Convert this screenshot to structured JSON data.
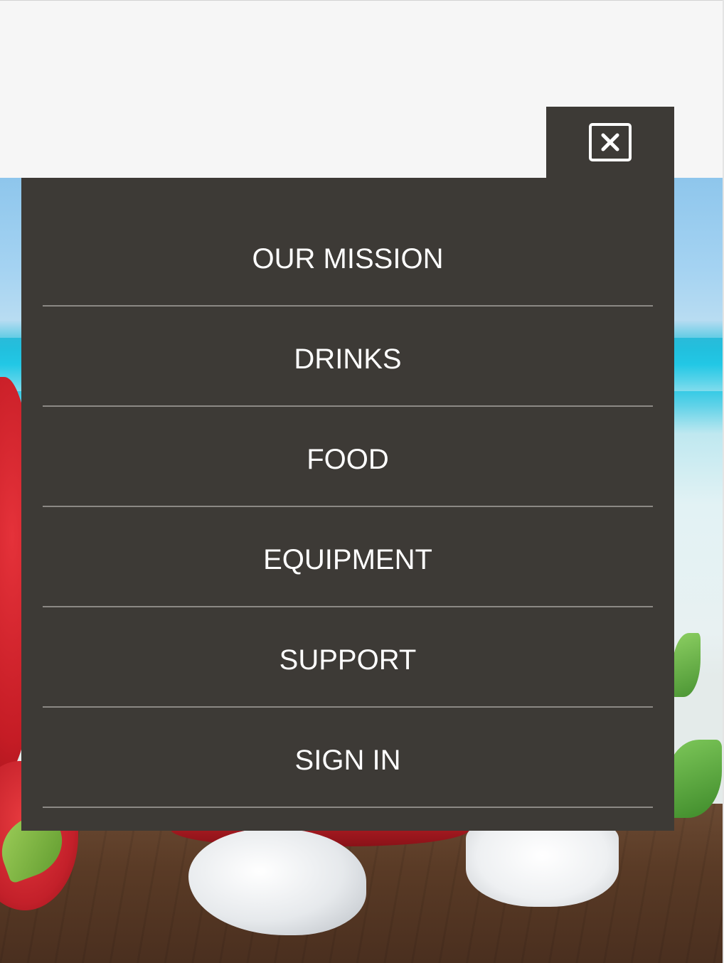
{
  "close_button": {
    "icon": "close-icon",
    "border_color": "#ffffff"
  },
  "menu": {
    "items": [
      {
        "label": "OUR MISSION"
      },
      {
        "label": "DRINKS"
      },
      {
        "label": "FOOD"
      },
      {
        "label": "EQUIPMENT"
      },
      {
        "label": "SUPPORT"
      },
      {
        "label": "SIGN IN"
      }
    ]
  },
  "colors": {
    "panel_background": "#3d3a36",
    "header_background": "#f6f6f6",
    "menu_text": "#ffffff",
    "divider": "#8c8985"
  }
}
